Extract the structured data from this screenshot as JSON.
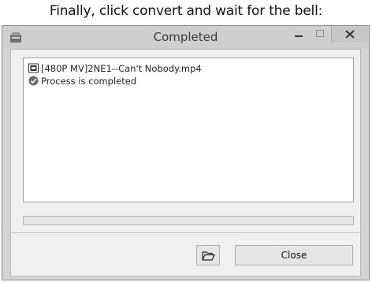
{
  "caption": "Finally, click convert and wait for the bell:",
  "window": {
    "title": "Completed",
    "app_icon": "app-icon",
    "controls": {
      "minimize_icon": "minimize-icon",
      "maximize_icon": "maximize-icon",
      "close_icon": "close-icon"
    }
  },
  "log": {
    "items": [
      {
        "icon": "video-file-icon",
        "text": "[480P MV]2NE1--Can't Nobody.mp4"
      },
      {
        "icon": "check-circle-icon",
        "text": "Process is completed"
      }
    ]
  },
  "progress": {
    "value": 0
  },
  "buttons": {
    "open_folder_icon": "folder-open-icon",
    "close_label": "Close"
  }
}
